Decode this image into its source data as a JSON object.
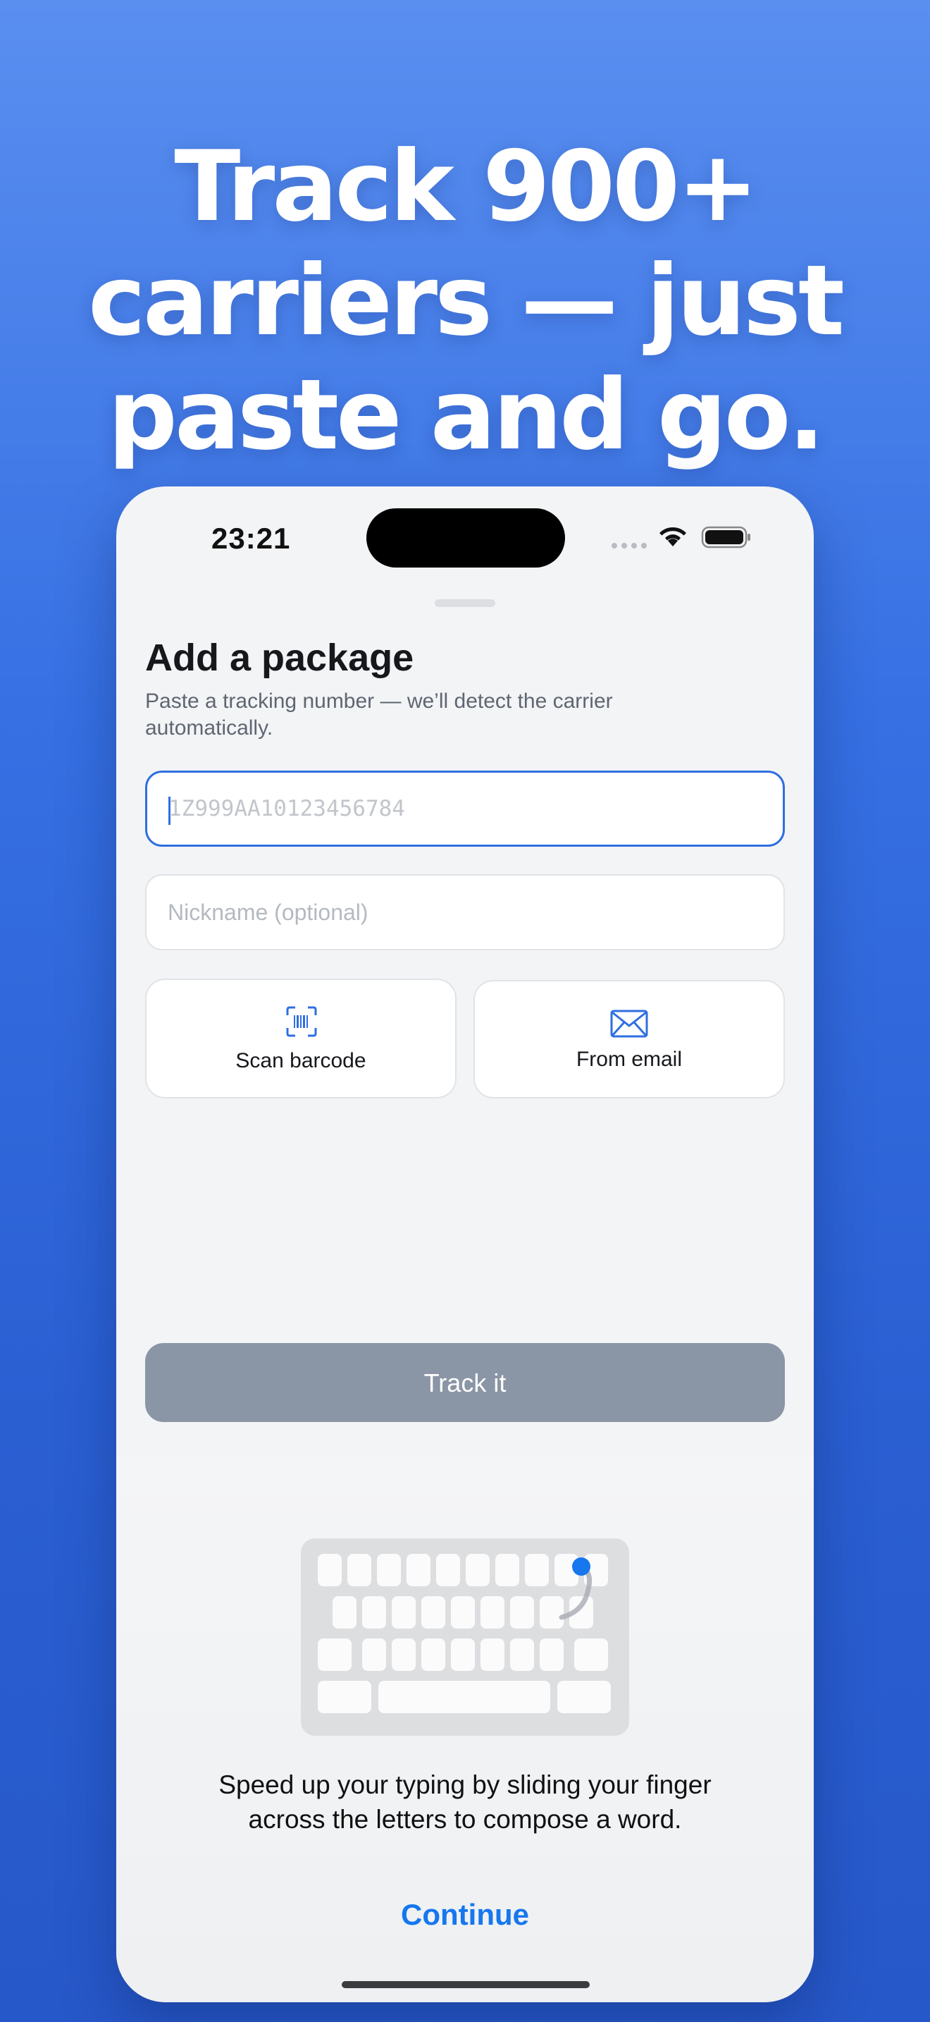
{
  "headline": {
    "line1": "Track 900+",
    "line2": "carriers — just",
    "line3": "paste and go."
  },
  "status_bar": {
    "time": "23:21",
    "icons": [
      "cellular-signal-icon",
      "wifi-icon",
      "battery-icon"
    ]
  },
  "sheet": {
    "title": "Add a package",
    "subtitle": "Paste a tracking number — we’ll detect the carrier automatically.",
    "tracking_placeholder": "1Z999AA10123456784",
    "tracking_value": "",
    "nickname_placeholder": "Nickname (optional)",
    "nickname_value": "",
    "scan_label": "Scan barcode",
    "scan_icon": "barcode-scan-icon",
    "email_label": "From email",
    "email_icon": "envelope-icon",
    "submit_label": "Track it"
  },
  "keyboard_tip": {
    "illustration": "slide-typing-keyboard-icon",
    "message": "Speed up your typing by sliding your finger across the letters to compose a word.",
    "continue_label": "Continue"
  },
  "colors": {
    "background_top": "#5a8ff0",
    "background_bottom": "#2758c9",
    "accent": "#2f6fe0",
    "link": "#1677ee",
    "disabled_button": "#8a95a5"
  }
}
